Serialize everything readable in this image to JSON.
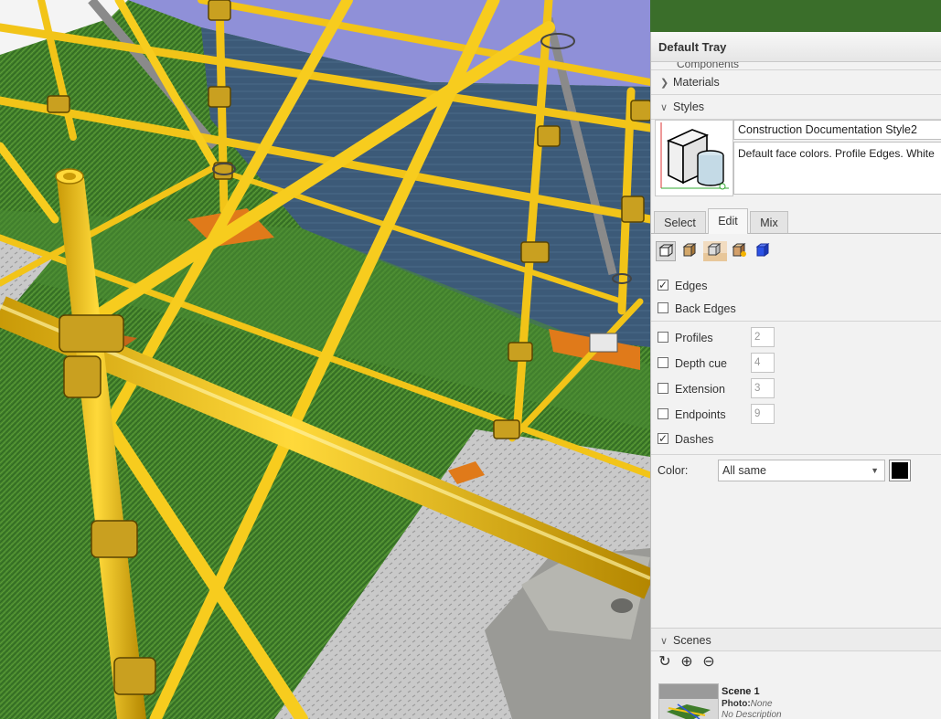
{
  "tray": {
    "title": "Default Tray",
    "panels": {
      "components_label": "Components",
      "materials_label": "Materials",
      "styles_label": "Styles",
      "scenes_label": "Scenes"
    },
    "style": {
      "name": "Construction Documentation Style2",
      "description": "Default face colors. Profile Edges. White"
    },
    "tabs": [
      {
        "label": "Select",
        "active": false
      },
      {
        "label": "Edit",
        "active": true
      },
      {
        "label": "Mix",
        "active": false
      }
    ],
    "edge_settings": [
      {
        "label": "Edges",
        "checked": true
      },
      {
        "label": "Back Edges",
        "checked": false
      },
      {
        "label": "Profiles",
        "checked": false,
        "value": "2"
      },
      {
        "label": "Depth cue",
        "checked": false,
        "value": "4"
      },
      {
        "label": "Extension",
        "checked": false,
        "value": "3"
      },
      {
        "label": "Endpoints",
        "checked": false,
        "value": "9"
      },
      {
        "label": "Dashes",
        "checked": true
      }
    ],
    "check_mark": "✓",
    "color": {
      "label": "Color:",
      "selected": "All same",
      "swatch": "#000000"
    },
    "scene": {
      "name": "Scene 1",
      "photo_label": "Photo:",
      "photo_value": "None",
      "description": "No Description"
    }
  },
  "icons": {
    "edit_bar": [
      "edge-settings-icon",
      "face-settings-icon",
      "background-settings-icon",
      "watermark-settings-icon",
      "modeling-settings-icon"
    ],
    "scenes_tools": [
      "refresh-icon",
      "add-scene-icon",
      "remove-scene-icon"
    ]
  },
  "colors": {
    "scaffold_yellow": "#f2c418",
    "grass": "#3f7d2a",
    "sky": "#8f90d8",
    "edit_cube_blue": "#2b52e6"
  }
}
